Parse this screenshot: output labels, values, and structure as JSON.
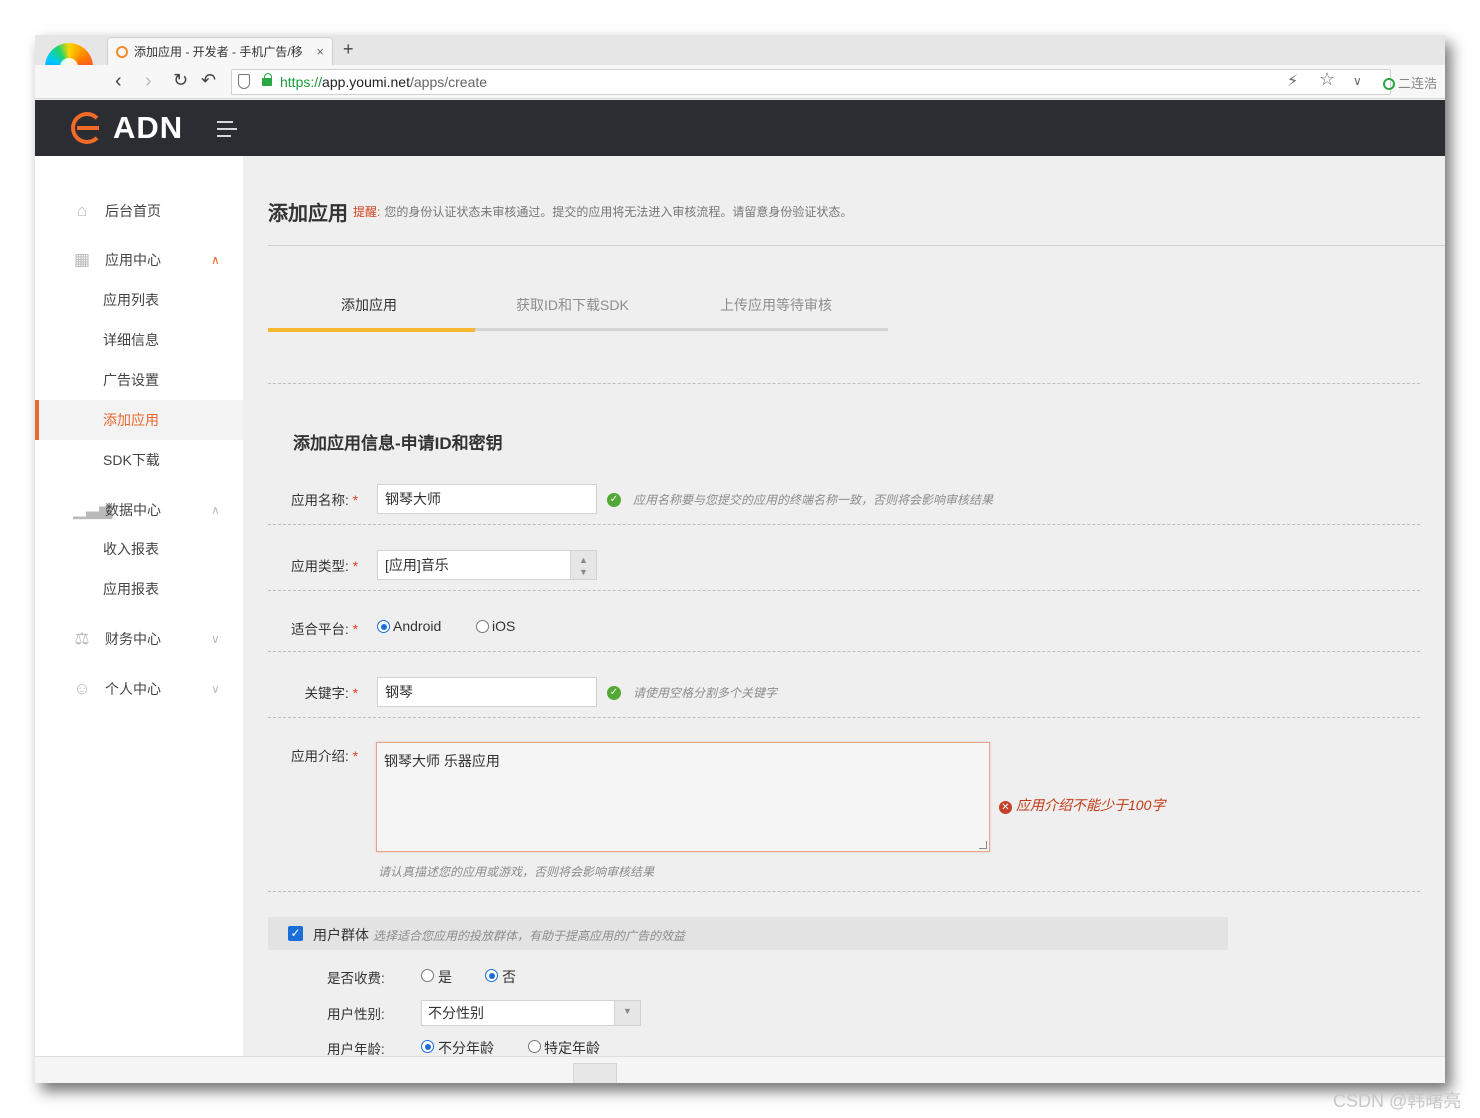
{
  "browser": {
    "tab_title": "添加应用 - 开发者 - 手机广告/移",
    "tab_close": "×",
    "new_tab": "+",
    "url_scheme": "https://",
    "url_host": "app.youmi.net",
    "url_path": "/apps/create",
    "extension_label": "二连浩"
  },
  "app": {
    "brand": "ADN",
    "accent_color": "#e8692f"
  },
  "sidebar": {
    "groups": [
      {
        "label": "后台首页",
        "icon": "home-icon"
      },
      {
        "label": "应用中心",
        "icon": "grid-icon",
        "expanded": true
      },
      {
        "label": "数据中心",
        "icon": "chart-icon",
        "expanded": true
      },
      {
        "label": "财务中心",
        "icon": "money-bag-icon",
        "expanded": false
      },
      {
        "label": "个人中心",
        "icon": "user-icon",
        "expanded": false
      }
    ],
    "app_items": [
      "应用列表",
      "详细信息",
      "广告设置",
      "添加应用",
      "SDK下载"
    ],
    "data_items": [
      "收入报表",
      "应用报表"
    ],
    "active_item": "添加应用"
  },
  "page": {
    "title": "添加应用",
    "notice_label": "提醒:",
    "notice_text": "您的身份认证状态未审核通过。提交的应用将无法进入审核流程。请留意身份验证状态。"
  },
  "steps": [
    "添加应用",
    "获取ID和下载SDK",
    "上传应用等待审核"
  ],
  "form": {
    "section_title": "添加应用信息-申请ID和密钥",
    "required_mark": "*",
    "app_name": {
      "label": "应用名称:",
      "value": "钢琴大师",
      "hint": "应用名称要与您提交的应用的终端名称一致，否则将会影响审核结果"
    },
    "app_type": {
      "label": "应用类型:",
      "value": "[应用]音乐"
    },
    "platform": {
      "label": "适合平台:",
      "options": [
        "Android",
        "iOS"
      ],
      "selected": "Android"
    },
    "keywords": {
      "label": "关键字:",
      "value": "钢琴",
      "hint": "请使用空格分割多个关键字"
    },
    "description": {
      "label": "应用介绍:",
      "value": "钢琴大师 乐器应用",
      "error": "应用介绍不能少于100字",
      "hint": "请认真描述您的应用或游戏，否则将会影响审核结果"
    },
    "audience": {
      "label": "用户群体",
      "hint": "选择适合您应用的投放群体，有助于提高应用的广告的效益",
      "checked": true,
      "paid": {
        "label": "是否收费:",
        "options": [
          "是",
          "否"
        ],
        "selected": "否"
      },
      "gender": {
        "label": "用户性别:",
        "value": "不分性别"
      },
      "age": {
        "label": "用户年龄:",
        "options": [
          "不分年龄",
          "特定年龄"
        ],
        "selected": "不分年龄"
      }
    }
  },
  "watermark": "CSDN @韩曙亮"
}
